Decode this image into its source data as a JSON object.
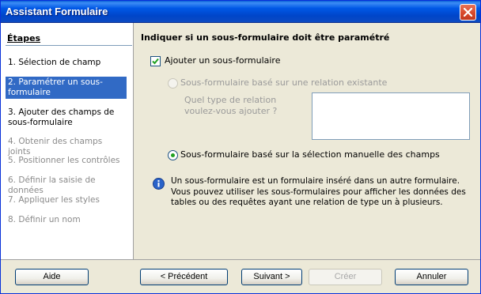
{
  "window": {
    "title": "Assistant Formulaire"
  },
  "sidebar": {
    "title": "Étapes",
    "steps": [
      {
        "label": "1. Sélection de champ",
        "state": "normal"
      },
      {
        "label": "2. Paramétrer un sous-formulaire",
        "state": "active"
      },
      {
        "label": "3. Ajouter des champs de sous-formulaire",
        "state": "normal"
      },
      {
        "label": "4. Obtenir des champs joints",
        "state": "disabled"
      },
      {
        "label": "5. Positionner les contrôles",
        "state": "disabled"
      },
      {
        "label": "6. Définir la saisie de données",
        "state": "disabled"
      },
      {
        "label": "7. Appliquer les styles",
        "state": "disabled"
      },
      {
        "label": "8. Définir un nom",
        "state": "disabled"
      }
    ]
  },
  "main": {
    "heading": "Indiquer si un sous-formulaire doit être paramétré",
    "add_subform": {
      "label": "Ajouter un sous-formulaire",
      "checked": true
    },
    "radio_existing": {
      "label": "Sous-formulaire basé sur une relation existante",
      "selected": false,
      "enabled": false
    },
    "relation_question": "Quel type de relation voulez-vous ajouter ?",
    "radio_manual": {
      "label": "Sous-formulaire basé sur la sélection manuelle des champs",
      "selected": true,
      "enabled": true
    },
    "info_text": "Un sous-formulaire est un formulaire inséré dans un autre formulaire. Vous pouvez utiliser les sous-formulaires pour afficher les données des tables ou des requêtes ayant une relation de type un à plusieurs."
  },
  "buttons": {
    "help": "Aide",
    "previous": "< Précédent",
    "next": "Suivant >",
    "create": "Créer",
    "cancel": "Annuler"
  },
  "colors": {
    "title_bar": "#0058e6",
    "selected_step": "#316ac5",
    "radio_dot": "#21a121",
    "window_bg": "#ece9d8"
  }
}
